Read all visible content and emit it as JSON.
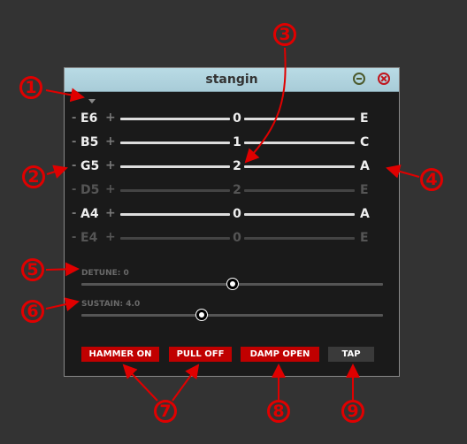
{
  "window": {
    "title": "stangin"
  },
  "strings": [
    {
      "note": "E6",
      "fret": "0",
      "output": "E",
      "muted": false
    },
    {
      "note": "B5",
      "fret": "1",
      "output": "C",
      "muted": false
    },
    {
      "note": "G5",
      "fret": "2",
      "output": "A",
      "muted": false
    },
    {
      "note": "D5",
      "fret": "2",
      "output": "E",
      "muted": true
    },
    {
      "note": "A4",
      "fret": "0",
      "output": "A",
      "muted": false
    },
    {
      "note": "E4",
      "fret": "0",
      "output": "E",
      "muted": true
    }
  ],
  "stepper": {
    "minus": "-",
    "plus": "+"
  },
  "detune": {
    "label": "DETUNE: 0",
    "value_fraction": 0.5
  },
  "sustain": {
    "label": "SUSTAIN: 4.0",
    "value_fraction": 0.4
  },
  "buttons": {
    "hammer_on": "HAMMER ON",
    "pull_off": "PULL OFF",
    "damp_open": "DAMP OPEN",
    "tap": "TAP"
  },
  "callouts": [
    "1",
    "2",
    "3",
    "4",
    "5",
    "6",
    "7",
    "8",
    "9"
  ],
  "colors": {
    "accent": "#c00000",
    "callout": "#e00000",
    "titlebar": "#b0d4df"
  }
}
